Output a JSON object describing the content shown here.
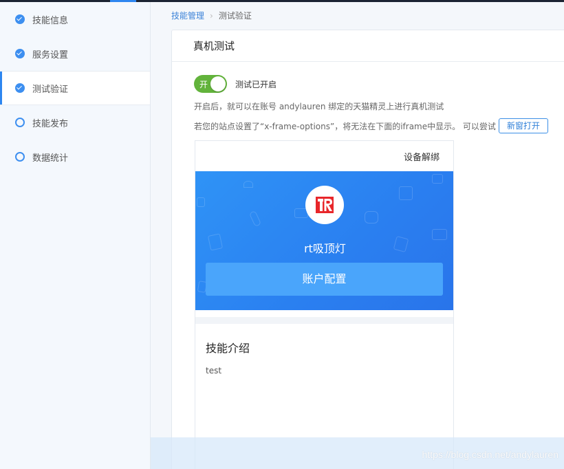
{
  "sidebar": {
    "items": [
      {
        "label": "技能信息",
        "state": "done"
      },
      {
        "label": "服务设置",
        "state": "done"
      },
      {
        "label": "测试验证",
        "state": "done",
        "active": true
      },
      {
        "label": "技能发布",
        "state": "todo"
      },
      {
        "label": "数据统计",
        "state": "todo"
      }
    ]
  },
  "breadcrumb": {
    "parent": "技能管理",
    "current": "测试验证"
  },
  "panel": {
    "title": "真机测试",
    "toggle_on_label": "开",
    "toggle_status": "测试已开启",
    "desc1": "开启后，就可以在账号 andylauren 绑定的天猫精灵上进行真机测试",
    "desc2": "若您的站点设置了“x-frame-options”，将无法在下面的iframe中显示。 可以尝试",
    "new_window_button": "新窗打开"
  },
  "device": {
    "unbind_label": "设备解绑",
    "skill_name": "rt吸顶灯",
    "account_button": "账户配置",
    "intro_title": "技能介绍",
    "intro_text": "test"
  },
  "watermark": "https://blog.csdn.net/andylauren",
  "colors": {
    "accent": "#2e86f0",
    "toggle_on": "#62b33b",
    "banner": "#2f93f6",
    "logo_red": "#e8262a"
  }
}
